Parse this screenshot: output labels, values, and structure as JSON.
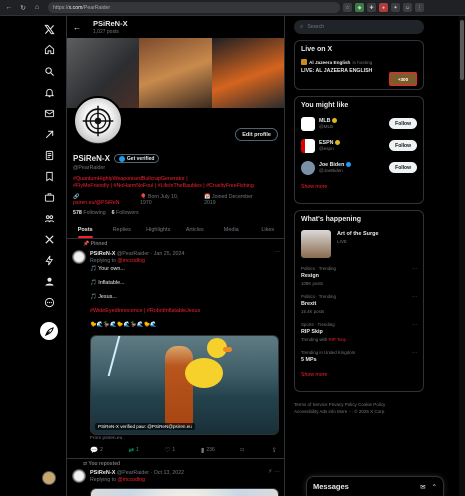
{
  "browser": {
    "url_prefix": "https://",
    "url_host": "x.com",
    "url_path": "/PearRaider"
  },
  "header": {
    "name": "PSiReN-X",
    "post_count": "1,027 posts"
  },
  "profile": {
    "display_name": "PSiReN-X",
    "verified_label": "Get verified",
    "handle": "@PearRaider",
    "bio_line1": "#QuantumHighlyWeaponisedBullcrapGenerator |",
    "bio_line2": "#FlyMeFriendly | #NoHarmNoFoul | #LifeInTheBaubles | #CrueltyFreeFishing",
    "website": "psiren.eu/@PSiReN",
    "born": "Born July 10, 1970",
    "joined": "Joined December 2019",
    "following_count": "578",
    "following_label": "Following",
    "followers_count": "6",
    "followers_label": "Followers",
    "edit_label": "Edit profile"
  },
  "tabs": [
    {
      "label": "Posts"
    },
    {
      "label": "Replies"
    },
    {
      "label": "Highlights"
    },
    {
      "label": "Articles"
    },
    {
      "label": "Media"
    },
    {
      "label": "Likes"
    }
  ],
  "posts": [
    {
      "context": "Pinned",
      "name": "PSiReN-X",
      "handle": "@PearRaider",
      "date": "Jan 25, 2024",
      "replying_prefix": "Replying to",
      "replying_to": "@mccodlog",
      "line1": "🎵 Your own...",
      "line2": "🎵 Inflatable...",
      "line3": "🎵 Jesus...",
      "tags": "#WideEyedInnocence | #RobotInflatableJesus",
      "emoji_row": "🐤🌊🦆🌊🐤🌊🦆🌊🐤🌊",
      "image_watermark": "PSiReN-X verified paw: @PSiReN@psiren.eu",
      "source": "From psiren.eu",
      "replies": "2",
      "reposts": "1",
      "likes": "1",
      "views": "236"
    },
    {
      "context": "You reposted",
      "name": "PSiReN-X",
      "handle": "@PearRaider",
      "date": "Oct 13, 2022",
      "replying_prefix": "Replying to",
      "replying_to": "@mccodlog"
    }
  ],
  "sidebar": {
    "search_placeholder": "Search",
    "live": {
      "title": "Live on X",
      "source": "Al Jazeera English",
      "status": "is hosting",
      "event": "LIVE: AL JAZEERA ENGLISH",
      "listeners": "+300"
    },
    "you_might_like": {
      "title": "You might like",
      "accounts": [
        {
          "name": "MLB",
          "handle": "@MLB",
          "follow": "Follow",
          "avatar_color": "#ffffff",
          "badge_color": "#e2b719"
        },
        {
          "name": "ESPN",
          "handle": "@espn",
          "follow": "Follow",
          "avatar_color": "#ffffff",
          "badge_color": "#e2b719"
        },
        {
          "name": "Joe Biden",
          "handle": "@JoeBiden",
          "follow": "Follow",
          "avatar_color": "#7a8fa8",
          "badge_color": "#1d9bf0"
        }
      ],
      "show_more": "Show more"
    },
    "happening": {
      "title": "What's happening",
      "hero_title": "Art of the Surge",
      "hero_status": "LIVE",
      "trends": [
        {
          "context": "Politics · Trending",
          "name": "Resign",
          "sub": "109K posts"
        },
        {
          "context": "Politics · Trending",
          "name": "Brexit",
          "sub": "15.4K posts"
        },
        {
          "context": "Sports · Trending",
          "name": "RIP Skip",
          "sub_prefix": "Trending with",
          "sub_link": "RIP Tony"
        },
        {
          "context": "Trending in United Kingdom",
          "name": "5 MPs",
          "sub": ""
        }
      ],
      "show_more": "Show more"
    },
    "footer": {
      "line1": "Terms of Service   Privacy Policy   Cookie Policy",
      "line2": "Accessibility   Ads info   More ···   © 2025 X Corp."
    }
  },
  "messages": {
    "title": "Messages"
  },
  "colors": {
    "accent": "#f4212e",
    "background": "#000000",
    "border": "#2f3336",
    "muted": "#71767b",
    "repost_green": "#00ba7c",
    "verified_blue": "#1d9bf0"
  }
}
